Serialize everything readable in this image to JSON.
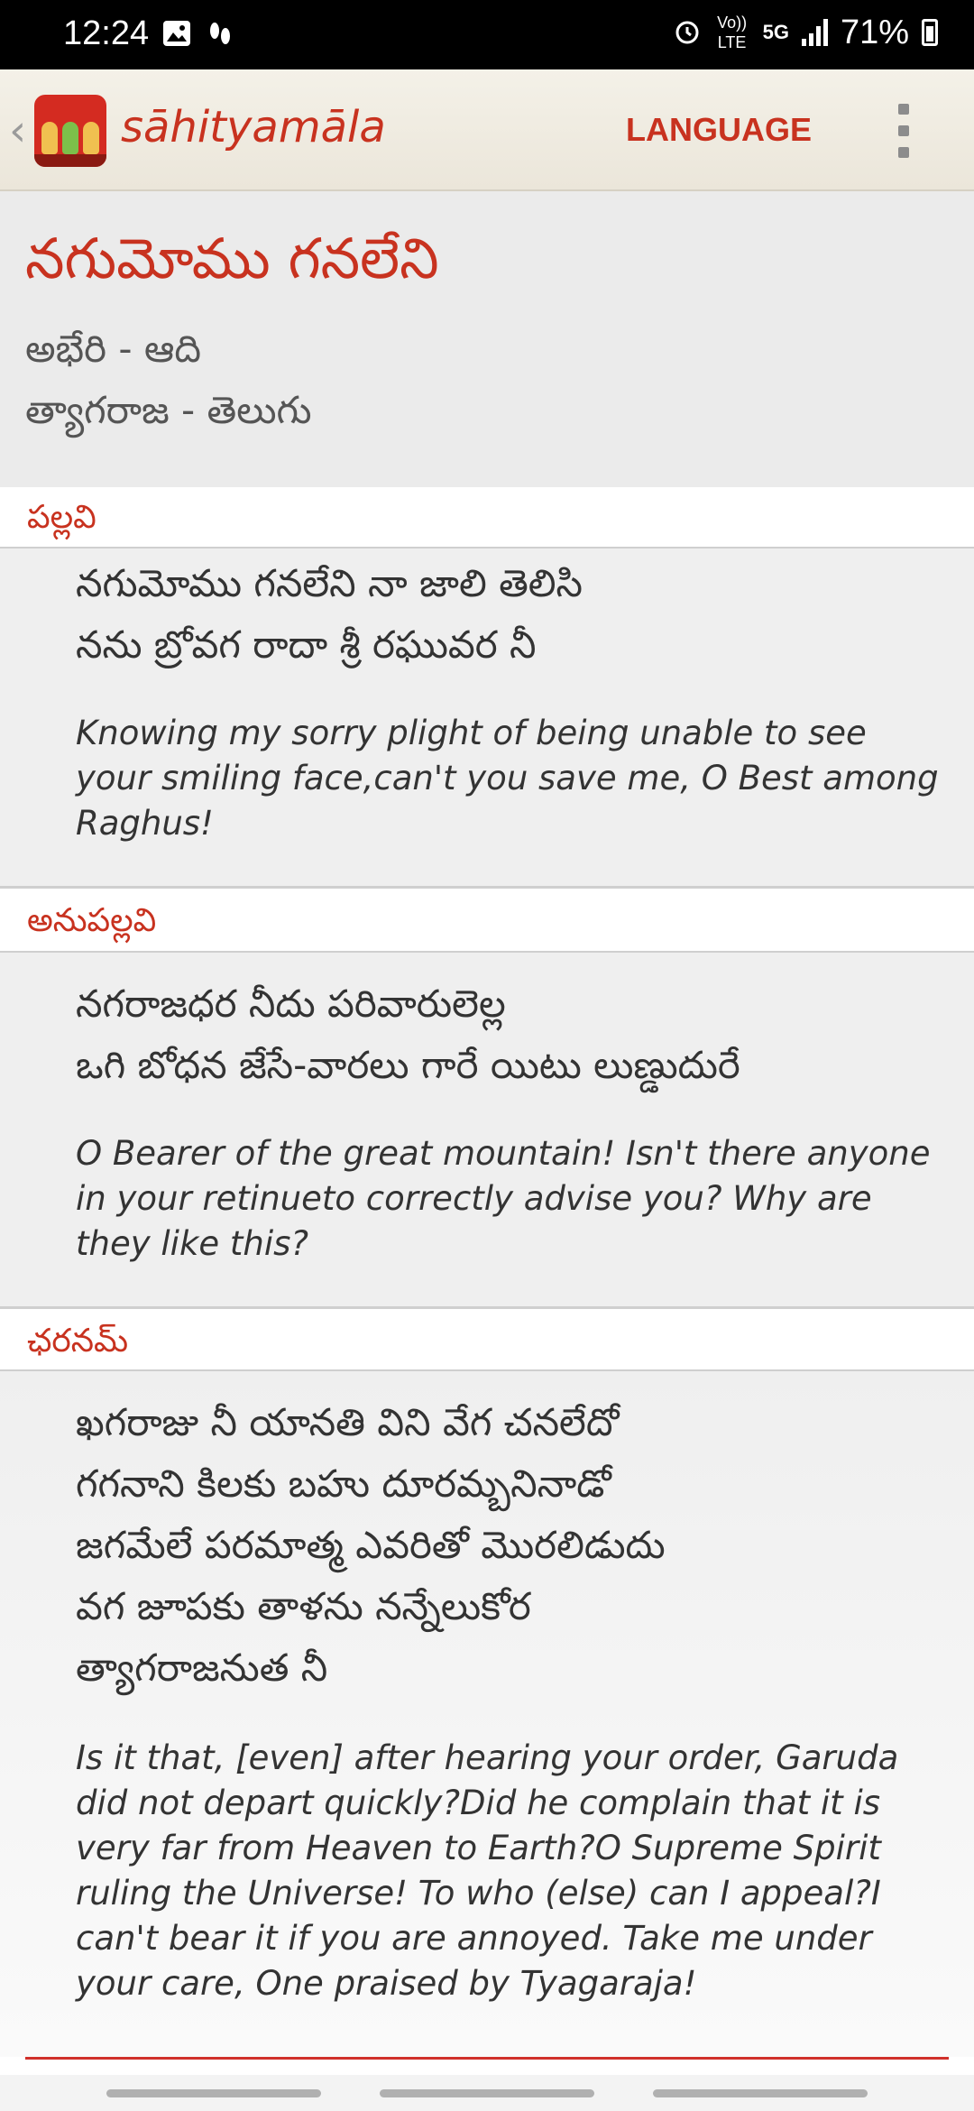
{
  "status_bar": {
    "time": "12:24",
    "volte": "Vo)) LTE",
    "network": "5G",
    "battery": "71%"
  },
  "app_bar": {
    "title": "sāhityamāla",
    "language_button": "LANGUAGE"
  },
  "song": {
    "title": "నగుమోము గనలేని",
    "raga_tala": "అభేరి - ఆది",
    "composer_language": "త్యాగరాజ - తెలుగు"
  },
  "sections": [
    {
      "label": "పల్లవి",
      "lines": [
        "నగుమోము గనలేని నా జాలి తెలిసి",
        "నను బ్రోవగ రాదా శ్రీ రఘువర నీ"
      ],
      "translation": "Knowing my sorry plight of being unable to see your smiling face,can't you save me, O Best among Raghus!"
    },
    {
      "label": "అనుపల్లవి",
      "lines": [
        "నగరాజధర నీదు పరివారులెల్ల",
        "ఒగి బోధన జేసే-వారలు గారే యిటు లుణ్డుదురే"
      ],
      "translation": "O Bearer of the great mountain! Isn't there anyone in your retinueto correctly advise you? Why are they like this?"
    },
    {
      "label": "ఛరనమ్",
      "lines": [
        "ఖగరాజు నీ యానతి విని వేగ చనలేదో",
        "గగనాని కిలకు బహు దూరమ్బనినాడో",
        "జగమేలే పరమాత్మ ఎవరితో మొరలిడుదు",
        "వగ జూపకు తాళను నన్నేలుకోర",
        "త్యాగరాజనుత నీ"
      ],
      "translation": "Is it that, [even] after hearing your order, Garuda did not depart quickly?Did he complain that it is very far from Heaven to Earth?O Supreme Spirit ruling the Universe! To who (else) can I appeal?I can't bear it if you are annoyed. Take me under your care, One praised by Tyagaraja!"
    }
  ],
  "colors": {
    "accent": "#c8321f",
    "status_bar": "#000000",
    "section_bg": "#efefef"
  },
  "icons": [
    "gallery-icon",
    "footsteps-icon",
    "alarm-icon",
    "signal-icon",
    "battery-icon",
    "back-chevron-icon",
    "app-logo",
    "overflow-menu-icon"
  ]
}
